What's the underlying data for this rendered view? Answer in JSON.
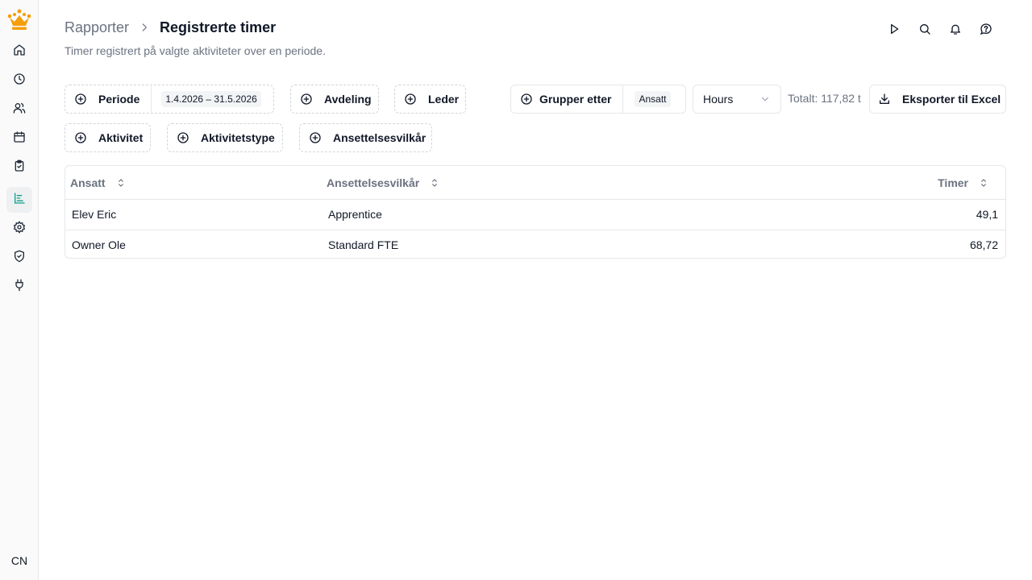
{
  "sidebar": {
    "logo_icon": "crown-icon",
    "items": [
      {
        "icon": "home-icon",
        "active": false
      },
      {
        "icon": "clock-icon",
        "active": false
      },
      {
        "icon": "users-icon",
        "active": false
      },
      {
        "icon": "calendar-icon",
        "active": false
      },
      {
        "icon": "clipboard-check-icon",
        "active": false
      },
      {
        "icon": "chart-icon",
        "active": true
      },
      {
        "icon": "gear-icon",
        "active": false
      },
      {
        "icon": "shield-check-icon",
        "active": false
      },
      {
        "icon": "plug-icon",
        "active": false
      }
    ],
    "avatar_initials": "CN",
    "accent_color": "#0f9f8e",
    "logo_color": "#f59e0b"
  },
  "header": {
    "breadcrumb_parent": "Rapporter",
    "title": "Registrerte timer",
    "subtitle": "Timer registrert på valgte aktiviteter over en periode.",
    "actions": [
      "play-icon",
      "search-icon",
      "bell-icon",
      "help-circle-icon"
    ]
  },
  "filters": {
    "periode_label": "Periode",
    "periode_value": "1.4.2026 – 31.5.2026",
    "avdeling_label": "Avdeling",
    "leder_label": "Leder",
    "aktivitet_label": "Aktivitet",
    "aktivitetstype_label": "Aktivitetstype",
    "ansettelsesvilkar_label": "Ansettelsesvilkår"
  },
  "toolbar": {
    "group_label": "Grupper etter",
    "group_value": "Ansatt",
    "unit_select": "Hours",
    "total": "Totalt: 117,82 t",
    "export_label": "Eksporter til Excel"
  },
  "table": {
    "columns": [
      "Ansatt",
      "Ansettelsesvilkår",
      "Timer"
    ],
    "rows": [
      [
        "Elev Eric",
        "Apprentice",
        "49,1"
      ],
      [
        "Owner Ole",
        "Standard FTE",
        "68,72"
      ]
    ]
  }
}
